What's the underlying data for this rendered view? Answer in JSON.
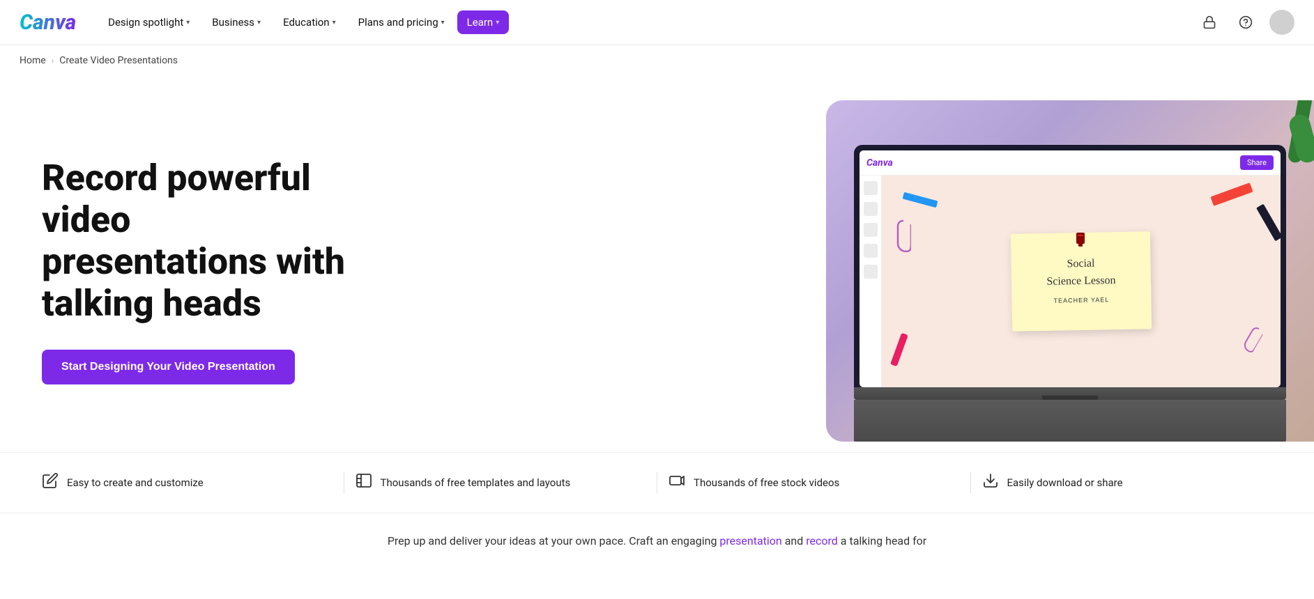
{
  "brand": {
    "name": "Canva",
    "logo_text": "Canva"
  },
  "nav": {
    "links": [
      {
        "label": "Design spotlight",
        "has_dropdown": true,
        "active": false
      },
      {
        "label": "Business",
        "has_dropdown": true,
        "active": false
      },
      {
        "label": "Education",
        "has_dropdown": true,
        "active": false
      },
      {
        "label": "Plans and pricing",
        "has_dropdown": true,
        "active": false
      },
      {
        "label": "Learn",
        "has_dropdown": true,
        "active": true
      }
    ],
    "icons": {
      "lock": "🔒",
      "help": "?"
    }
  },
  "breadcrumb": {
    "home": "Home",
    "current": "Create Video Presentations"
  },
  "hero": {
    "title": "Record powerful video presentations with talking heads",
    "cta_label": "Start Designing Your Video Presentation"
  },
  "features": [
    {
      "icon": "✏️",
      "text": "Easy to create and customize"
    },
    {
      "icon": "⬜",
      "text": "Thousands of free templates and layouts"
    },
    {
      "icon": "🖥️",
      "text": "Thousands of free stock videos"
    },
    {
      "icon": "⬇️",
      "text": "Easily download or share"
    }
  ],
  "bottom_teaser": {
    "text_before": "Prep up and deliver your ideas at your own pace. Craft an engaging ",
    "link1_text": "presentation",
    "text_between": " and ",
    "link2_text": "record",
    "text_after": " a talking head for"
  },
  "slide": {
    "title_line1": "Social",
    "title_line2": "Science Lesson",
    "subtitle": "TEACHER YAEL"
  }
}
